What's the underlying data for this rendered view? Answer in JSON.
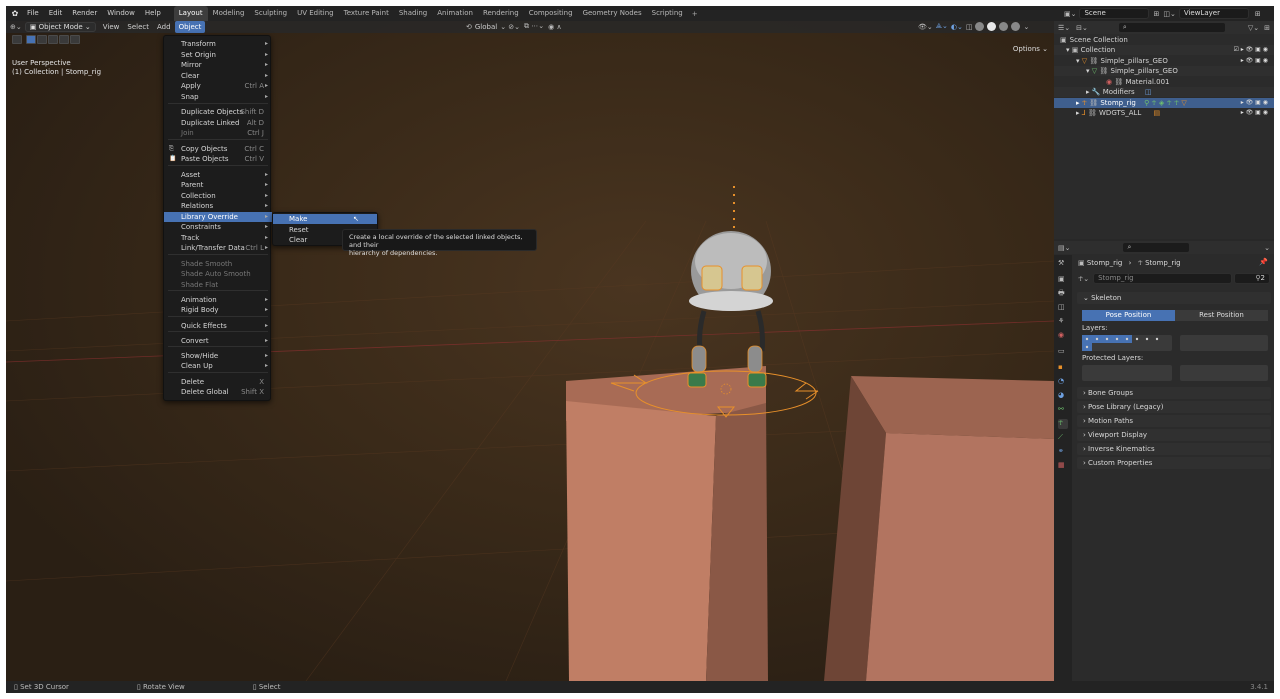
{
  "topbar": {
    "menus": [
      "File",
      "Edit",
      "Render",
      "Window",
      "Help"
    ],
    "workspaces": [
      "Layout",
      "Modeling",
      "Sculpting",
      "UV Editing",
      "Texture Paint",
      "Shading",
      "Animation",
      "Rendering",
      "Compositing",
      "Geometry Nodes",
      "Scripting"
    ],
    "active_workspace": "Layout",
    "scene": "Scene",
    "view_layer": "ViewLayer"
  },
  "viewport": {
    "mode": "Object Mode",
    "menus": [
      "View",
      "Select",
      "Add",
      "Object"
    ],
    "open_menu": "Object",
    "transform_orientation": "Global",
    "options_label": "Options",
    "info_line1": "User Perspective",
    "info_line2": "(1) Collection | Stomp_rig"
  },
  "object_menu": {
    "items": [
      {
        "label": "Transform",
        "shortcut": "",
        "submenu": true
      },
      {
        "label": "Set Origin",
        "shortcut": "",
        "submenu": true
      },
      {
        "label": "Mirror",
        "shortcut": "",
        "submenu": true
      },
      {
        "label": "Clear",
        "shortcut": "",
        "submenu": true
      },
      {
        "label": "Apply",
        "shortcut": "Ctrl A",
        "submenu": true
      },
      {
        "label": "Snap",
        "shortcut": "",
        "submenu": true
      },
      {
        "label": "Duplicate Objects",
        "shortcut": "Shift D",
        "submenu": false
      },
      {
        "label": "Duplicate Linked",
        "shortcut": "Alt D",
        "submenu": false
      },
      {
        "label": "Join",
        "shortcut": "Ctrl J",
        "submenu": false,
        "disabled": true
      },
      {
        "label": "Copy Objects",
        "shortcut": "Ctrl C",
        "submenu": false,
        "icon": "copy-icon"
      },
      {
        "label": "Paste Objects",
        "shortcut": "Ctrl V",
        "submenu": false,
        "icon": "paste-icon"
      },
      {
        "label": "Asset",
        "shortcut": "",
        "submenu": true
      },
      {
        "label": "Parent",
        "shortcut": "",
        "submenu": true
      },
      {
        "label": "Collection",
        "shortcut": "",
        "submenu": true
      },
      {
        "label": "Relations",
        "shortcut": "",
        "submenu": true
      },
      {
        "label": "Library Override",
        "shortcut": "",
        "submenu": true,
        "highlighted": true
      },
      {
        "label": "Constraints",
        "shortcut": "",
        "submenu": true
      },
      {
        "label": "Track",
        "shortcut": "",
        "submenu": true
      },
      {
        "label": "Link/Transfer Data",
        "shortcut": "Ctrl L",
        "submenu": true
      },
      {
        "label": "Shade Smooth",
        "shortcut": "",
        "submenu": false,
        "disabled": true
      },
      {
        "label": "Shade Auto Smooth",
        "shortcut": "",
        "submenu": false,
        "disabled": true
      },
      {
        "label": "Shade Flat",
        "shortcut": "",
        "submenu": false,
        "disabled": true
      },
      {
        "label": "Animation",
        "shortcut": "",
        "submenu": true
      },
      {
        "label": "Rigid Body",
        "shortcut": "",
        "submenu": true
      },
      {
        "label": "Quick Effects",
        "shortcut": "",
        "submenu": true
      },
      {
        "label": "Convert",
        "shortcut": "",
        "submenu": true
      },
      {
        "label": "Show/Hide",
        "shortcut": "",
        "submenu": true
      },
      {
        "label": "Clean Up",
        "shortcut": "",
        "submenu": true
      },
      {
        "label": "Delete",
        "shortcut": "X",
        "submenu": false
      },
      {
        "label": "Delete Global",
        "shortcut": "Shift X",
        "submenu": false
      }
    ]
  },
  "override_submenu": {
    "items": [
      "Make",
      "Reset",
      "Clear"
    ],
    "highlighted": "Make"
  },
  "tooltip": {
    "line1": "Create a local override of the selected linked objects, and their",
    "line2": "hierarchy of dependencies."
  },
  "outliner": {
    "root": "Scene Collection",
    "rows": [
      {
        "label": "Collection",
        "depth": 0
      },
      {
        "label": "Simple_pillars_GEO",
        "depth": 1
      },
      {
        "label": "Simple_pillars_GEO",
        "depth": 2
      },
      {
        "label": "Material.001",
        "depth": 3
      },
      {
        "label": "Modifiers",
        "depth": 2
      },
      {
        "label": "Stomp_rig",
        "depth": 1,
        "selected": true
      },
      {
        "label": "WDGTS_ALL",
        "depth": 1
      }
    ]
  },
  "properties": {
    "breadcrumb_object": "Stomp_rig",
    "breadcrumb_data": "Stomp_rig",
    "data_name": "Stomp_rig",
    "user_count": "2",
    "skeleton_label": "Skeleton",
    "pose_position": "Pose Position",
    "rest_position": "Rest Position",
    "layers_label": "Layers:",
    "protected_layers_label": "Protected Layers:",
    "panels": [
      "Bone Groups",
      "Pose Library (Legacy)",
      "Motion Paths",
      "Viewport Display",
      "Inverse Kinematics",
      "Custom Properties"
    ]
  },
  "statusbar": {
    "items": [
      "Set 3D Cursor",
      "Rotate View",
      "Select"
    ],
    "version": "3.4.1"
  },
  "colors": {
    "accent": "#4772b3",
    "selection_orange": "#e8902a"
  }
}
